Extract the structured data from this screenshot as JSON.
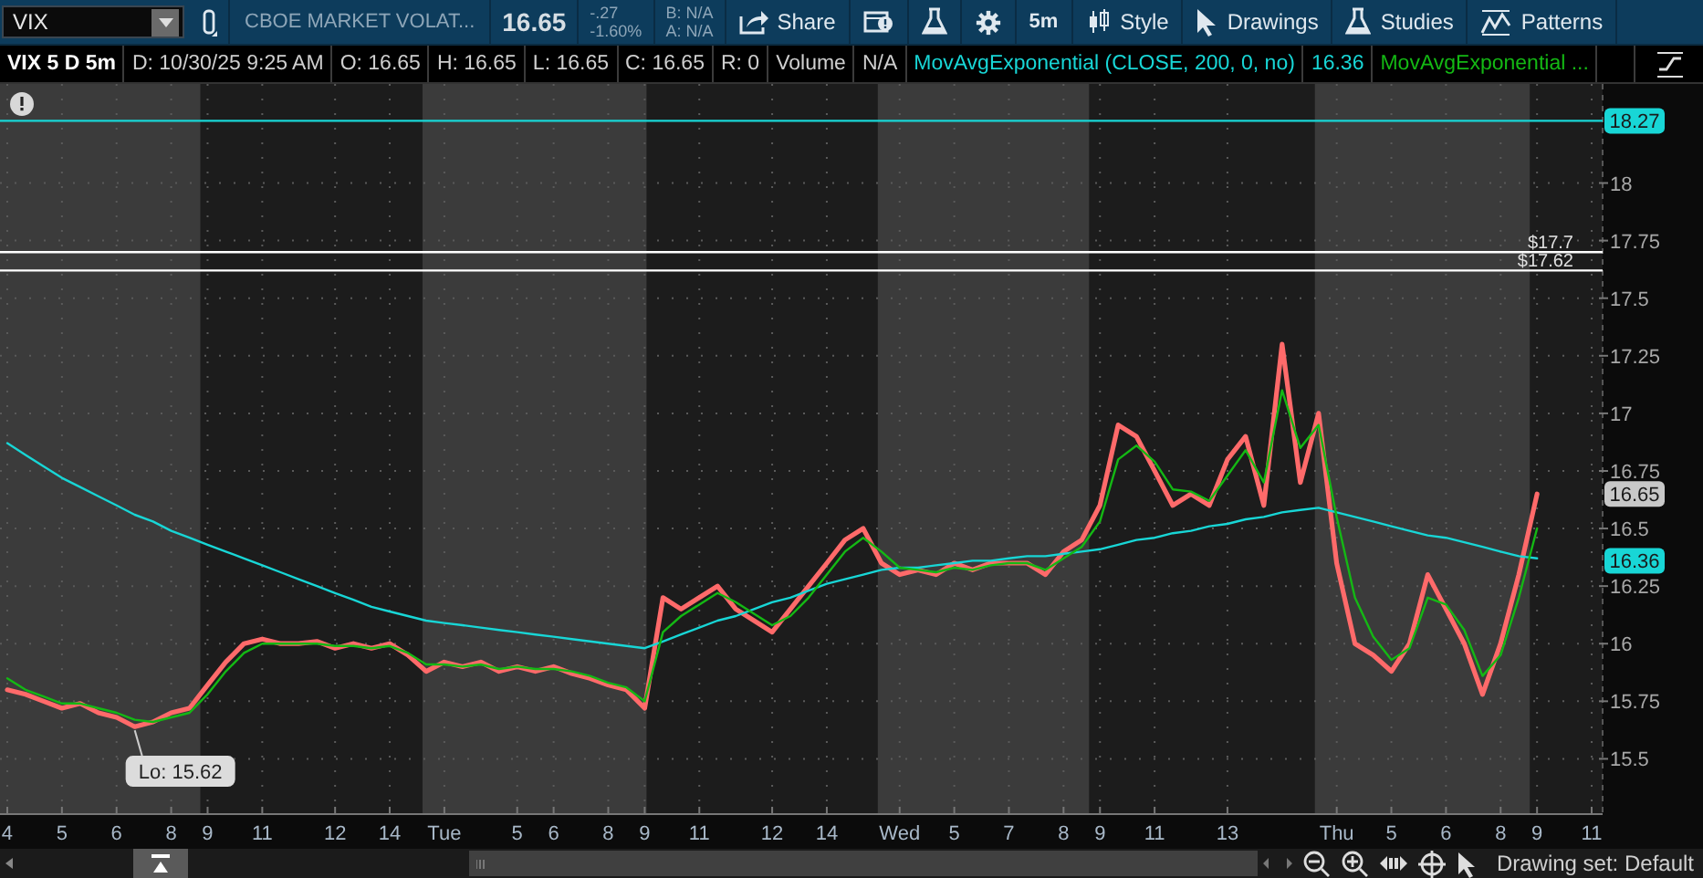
{
  "toolbar": {
    "symbol": "VIX",
    "description": "CBOE MARKET VOLAT...",
    "last": "16.65",
    "change": "-.27",
    "change_pct": "-1.60%",
    "bid": "B: N/A",
    "ask": "A: N/A",
    "buttons": [
      {
        "kind": "share",
        "label": "Share"
      },
      {
        "kind": "news"
      },
      {
        "kind": "flask"
      },
      {
        "kind": "gear"
      },
      {
        "kind": "text",
        "label": "5m"
      },
      {
        "kind": "style",
        "label": "Style"
      },
      {
        "kind": "cursor",
        "label": "Drawings"
      },
      {
        "kind": "flask",
        "label": "Studies"
      },
      {
        "kind": "pattern",
        "label": "Patterns"
      }
    ]
  },
  "info_bar": {
    "title": "VIX 5 D 5m",
    "cells": [
      "D: 10/30/25 9:25 AM",
      "O: 16.65",
      "H: 16.65",
      "L: 16.65",
      "C: 16.65",
      "R: 0",
      "Volume",
      "N/A"
    ],
    "study_value": "16.36"
  },
  "chart": {
    "chart_data": {
      "type": "line",
      "ylim": [
        15.26,
        18.43
      ],
      "categories": [
        "4",
        null,
        null,
        "5",
        null,
        null,
        "6",
        null,
        null,
        "8",
        null,
        "9",
        null,
        null,
        "11",
        null,
        null,
        null,
        "12",
        null,
        null,
        "14",
        null,
        null,
        "Tue",
        null,
        null,
        null,
        "5",
        null,
        "6",
        null,
        null,
        "8",
        null,
        "9",
        null,
        null,
        "11",
        null,
        null,
        null,
        "12",
        null,
        null,
        "14",
        null,
        null,
        null,
        "Wed",
        null,
        null,
        "5",
        null,
        null,
        "7",
        null,
        null,
        "8",
        null,
        "9",
        null,
        null,
        "11",
        null,
        null,
        null,
        "13",
        null,
        null,
        null,
        null,
        null,
        "Thu",
        null,
        null,
        "5",
        null,
        null,
        "6",
        null,
        null,
        "8",
        null,
        "9",
        null,
        null,
        "11"
      ],
      "series": [
        {
          "color": "#ff6a6a",
          "values": [
            15.8,
            15.78,
            15.75,
            15.72,
            15.74,
            15.7,
            15.68,
            15.64,
            15.66,
            15.7,
            15.72,
            15.82,
            15.92,
            16.0,
            16.02,
            16.0,
            16.0,
            16.01,
            15.98,
            16.0,
            15.98,
            16.0,
            15.95,
            15.88,
            15.92,
            15.9,
            15.92,
            15.88,
            15.9,
            15.88,
            15.9,
            15.87,
            15.85,
            15.82,
            15.8,
            15.72,
            16.2,
            16.15,
            16.2,
            16.25,
            16.15,
            16.1,
            16.05,
            16.15,
            16.25,
            16.35,
            16.45,
            16.5,
            16.35,
            16.3,
            16.32,
            16.3,
            16.35,
            16.32,
            16.35,
            16.35,
            16.35,
            16.3,
            16.4,
            16.45,
            16.6,
            16.95,
            16.9,
            16.75,
            16.6,
            16.65,
            16.6,
            16.8,
            16.9,
            16.6,
            17.3,
            16.7,
            17.0,
            16.35,
            16.0,
            15.95,
            15.88,
            16.0,
            16.3,
            16.15,
            16.0,
            15.78,
            16.0,
            16.3,
            16.65,
            null,
            null,
            null
          ]
        },
        {
          "name": "MovAvgExponential (CLOSE, 200, 0, no)",
          "color": "#18d6d6",
          "values": [
            16.87,
            16.82,
            16.77,
            16.72,
            16.68,
            16.64,
            16.6,
            16.56,
            16.53,
            16.49,
            16.46,
            16.43,
            16.4,
            16.37,
            16.34,
            16.31,
            16.28,
            16.25,
            16.22,
            16.19,
            16.16,
            16.14,
            16.12,
            16.1,
            16.09,
            16.08,
            16.07,
            16.06,
            16.05,
            16.04,
            16.03,
            16.02,
            16.01,
            16.0,
            15.99,
            15.98,
            16.01,
            16.04,
            16.07,
            16.1,
            16.12,
            16.15,
            16.18,
            16.2,
            16.23,
            16.26,
            16.28,
            16.3,
            16.32,
            16.33,
            16.33,
            16.34,
            16.35,
            16.36,
            16.36,
            16.37,
            16.38,
            16.38,
            16.39,
            16.4,
            16.41,
            16.43,
            16.45,
            16.46,
            16.48,
            16.49,
            16.51,
            16.52,
            16.54,
            16.55,
            16.57,
            16.58,
            16.59,
            16.57,
            16.55,
            16.53,
            16.51,
            16.49,
            16.47,
            16.46,
            16.44,
            16.42,
            16.4,
            16.38,
            16.37,
            null,
            null,
            null
          ]
        },
        {
          "name": "MovAvgExponential ...",
          "color": "#14b814",
          "values": [
            15.85,
            15.8,
            15.77,
            15.74,
            15.74,
            15.72,
            15.7,
            15.67,
            15.66,
            15.68,
            15.7,
            15.78,
            15.88,
            15.96,
            16.0,
            16.0,
            16.0,
            16.0,
            15.99,
            15.99,
            15.98,
            15.99,
            15.96,
            15.91,
            15.91,
            15.9,
            15.91,
            15.89,
            15.9,
            15.89,
            15.89,
            15.88,
            15.86,
            15.83,
            15.81,
            15.75,
            16.05,
            16.12,
            16.17,
            16.22,
            16.18,
            16.13,
            16.08,
            16.12,
            16.2,
            16.3,
            16.4,
            16.46,
            16.4,
            16.33,
            16.32,
            16.31,
            16.33,
            16.32,
            16.34,
            16.35,
            16.35,
            16.32,
            16.37,
            16.42,
            16.53,
            16.8,
            16.86,
            16.79,
            16.67,
            16.66,
            16.62,
            16.73,
            16.84,
            16.7,
            17.1,
            16.85,
            16.95,
            16.55,
            16.2,
            16.03,
            15.93,
            15.98,
            16.2,
            16.17,
            16.06,
            15.86,
            15.95,
            16.2,
            16.5,
            null,
            null,
            null
          ]
        }
      ],
      "yticks": [
        15.5,
        15.75,
        16,
        16.25,
        16.5,
        16.75,
        17,
        17.25,
        17.5,
        17.75,
        18
      ],
      "grid": true,
      "ref_lines": [
        {
          "axis": "y",
          "value": 18.27,
          "color": "#18d6d6"
        },
        {
          "axis": "y",
          "value": 17.7,
          "color": "#ffffff",
          "label": "$17.7"
        },
        {
          "axis": "y",
          "value": 17.62,
          "color": "#ffffff",
          "label": "$17.62"
        }
      ],
      "annotations": [
        {
          "y": 18.27,
          "text": "18.27"
        },
        {
          "y": 16.65,
          "text": "16.65"
        },
        {
          "y": 16.36,
          "text": "16.36"
        }
      ]
    },
    "low_label": "Lo: 15.62"
  },
  "status_bar": {
    "drawing_set": "Drawing set: Default"
  }
}
